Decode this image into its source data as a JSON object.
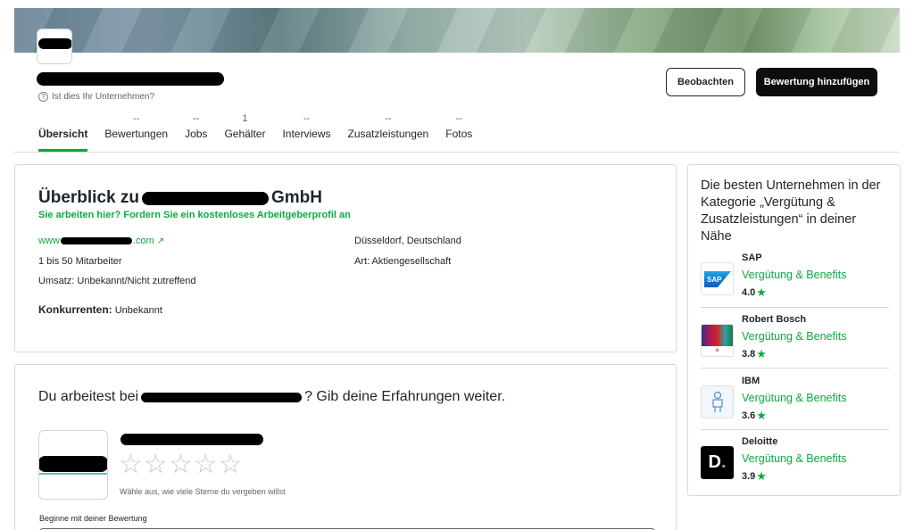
{
  "header": {
    "claim_text": "Ist dies Ihr Unternehmen?",
    "watch_label": "Beobachten",
    "add_review_label": "Bewertung hinzufügen"
  },
  "tabs": [
    {
      "label": "Übersicht",
      "count": ""
    },
    {
      "label": "Bewertungen",
      "count": "--"
    },
    {
      "label": "Jobs",
      "count": "--"
    },
    {
      "label": "Gehälter",
      "count": "1"
    },
    {
      "label": "Interviews",
      "count": "--"
    },
    {
      "label": "Zusatzleistungen",
      "count": "--"
    },
    {
      "label": "Fotos",
      "count": "--"
    }
  ],
  "overview": {
    "title_prefix": "Überblick zu",
    "title_suffix": "GmbH",
    "claim_profile": "Sie arbeiten hier? Fordern Sie ein kostenloses Arbeitgeberprofil an",
    "website_prefix": "www",
    "website_suffix": ".com",
    "location": "Düsseldorf, Deutschland",
    "employees": "1 bis 50 Mitarbeiter",
    "type": "Art: Aktiengesellschaft",
    "revenue": "Umsatz: Unbekannt/Nicht zutreffend",
    "competitors_label": "Konkurrenten:",
    "competitors_value": "Unbekannt"
  },
  "share": {
    "title_prefix": "Du arbeitest bei",
    "title_suffix": "? Gib deine Erfahrungen weiter.",
    "stars_hint": "Wähle aus, wie viele Sterne du vergeben willst",
    "start_label": "Beginne mit deiner Bewertung"
  },
  "sidebar": {
    "title": "Die besten Unternehmen in der Kategorie „Vergütung & Zusatzleistungen“ in deiner Nähe",
    "companies": [
      {
        "name": "SAP",
        "category": "Vergütung & Benefits",
        "rating": "4.0"
      },
      {
        "name": "Robert Bosch",
        "category": "Vergütung & Benefits",
        "rating": "3.8"
      },
      {
        "name": "IBM",
        "category": "Vergütung & Benefits",
        "rating": "3.6"
      },
      {
        "name": "Deloitte",
        "category": "Vergütung & Benefits",
        "rating": "3.9"
      }
    ]
  },
  "colors": {
    "accent_green": "#0caa41",
    "text_dark": "#20262e",
    "button_dark": "#0d0d0d"
  }
}
